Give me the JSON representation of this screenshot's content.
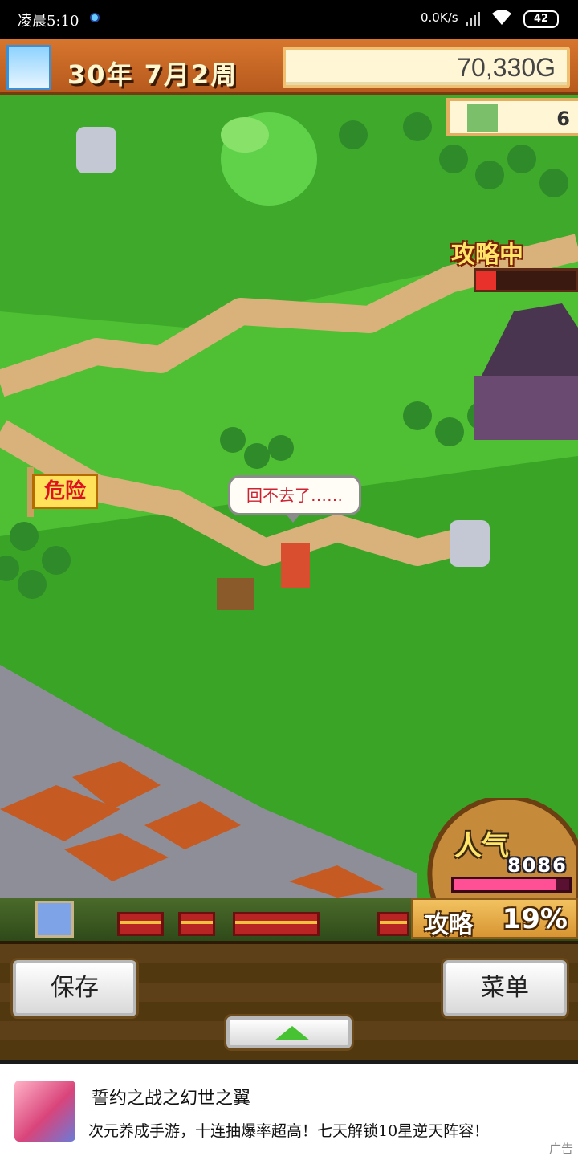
{
  "status_bar": {
    "time": "凌晨5:10",
    "network_speed": "0.0K/s",
    "battery": "42"
  },
  "hud": {
    "date": "30年 7月2周",
    "gold": "70,330G",
    "town_count": "6"
  },
  "map": {
    "siege_label": "攻略中",
    "siege_progress": 0.2,
    "danger_flag": "危险",
    "speech": "回不去了……"
  },
  "stats": {
    "popularity_label": "人气",
    "popularity_value": "8086",
    "popularity_fill": 0.88,
    "progress_label": "攻略",
    "progress_value": "19%"
  },
  "controls": {
    "save_label": "保存",
    "menu_label": "菜单"
  },
  "ad": {
    "title": "誓约之战之幻世之翼",
    "description": "次元养成手游，十连抽爆率超高！七天解锁10星逆天阵容！",
    "tag": "广告"
  },
  "colors": {
    "grass": "#3ea92a",
    "path": "#d8b27a",
    "hud_orange": "#c9682a",
    "siege_red": "#e8312a",
    "popularity_pink": "#ff4f95"
  }
}
